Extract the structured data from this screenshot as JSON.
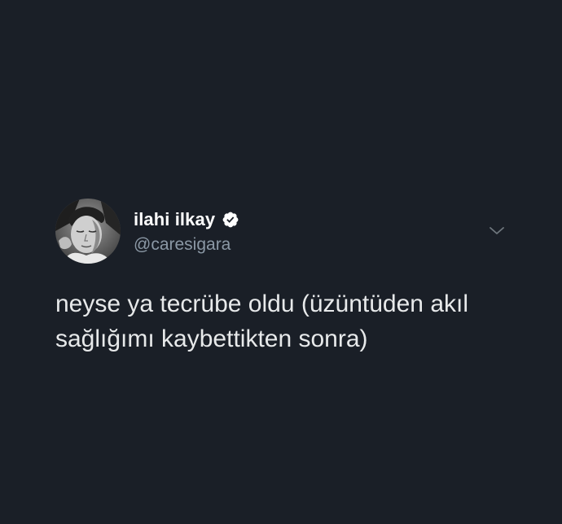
{
  "tweet": {
    "author": {
      "display_name": "ilahi ilkay",
      "handle": "@caresigara",
      "verified": true,
      "avatar_icon": "avatar-photo-icon",
      "verified_icon": "verified-badge-icon"
    },
    "text": "neyse ya tecrübe oldu (üzüntüden akıl\nsağlığımı kaybettikten sonra)",
    "menu_icon": "chevron-down-icon"
  },
  "colors": {
    "background": "#1a1f27",
    "name": "#ffffff",
    "handle": "#8b98a5",
    "text": "#e7e9ea"
  }
}
